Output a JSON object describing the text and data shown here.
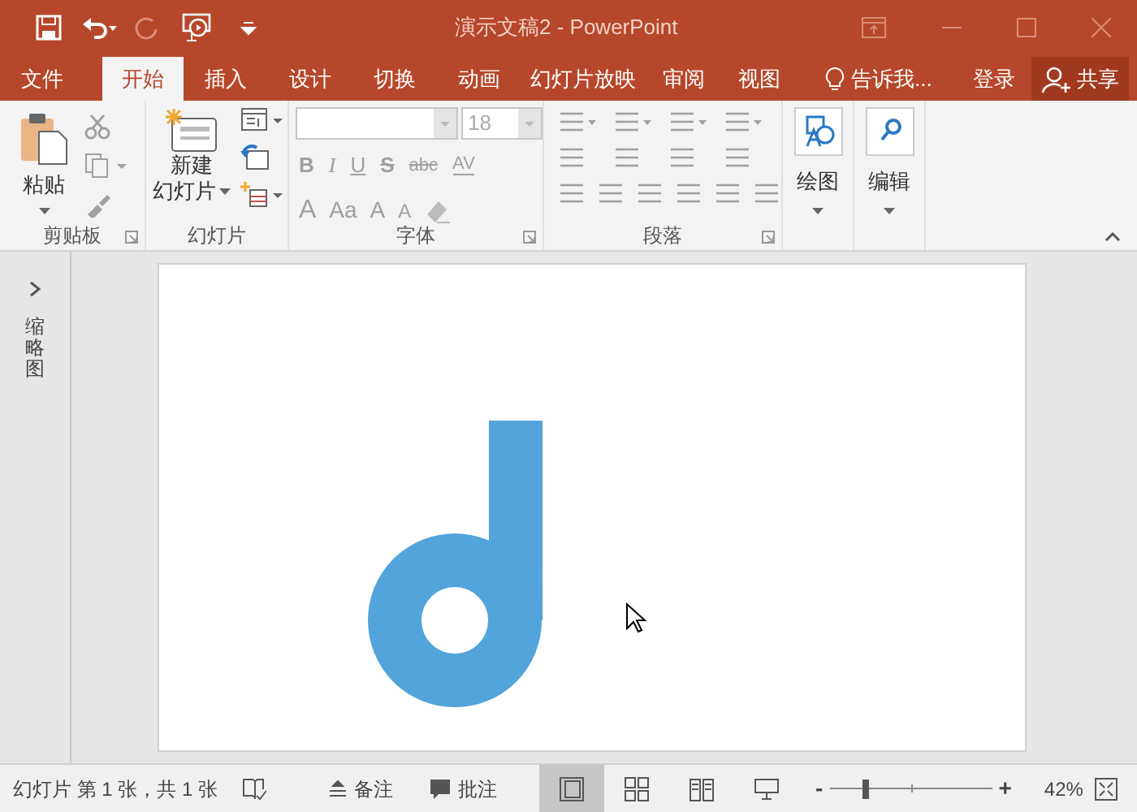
{
  "window": {
    "title": "演示文稿2 - PowerPoint"
  },
  "tabs": [
    {
      "label": "文件",
      "selected": false
    },
    {
      "label": "开始",
      "selected": true
    },
    {
      "label": "插入",
      "selected": false
    },
    {
      "label": "设计",
      "selected": false
    },
    {
      "label": "切换",
      "selected": false
    },
    {
      "label": "动画",
      "selected": false
    },
    {
      "label": "幻灯片放映",
      "selected": false
    },
    {
      "label": "审阅",
      "selected": false
    },
    {
      "label": "视图",
      "selected": false
    }
  ],
  "tell_me": "告诉我...",
  "sign_in": "登录",
  "share": "共享",
  "ribbon": {
    "groups": [
      {
        "label": "剪贴板",
        "launcher": true
      },
      {
        "label": "幻灯片",
        "launcher": false
      },
      {
        "label": "字体",
        "launcher": true
      },
      {
        "label": "段落",
        "launcher": true
      }
    ],
    "paste": "粘贴",
    "new_slide": [
      "新建",
      "幻灯片"
    ],
    "font_size": "18",
    "font_buttons": [
      "B",
      "I",
      "U",
      "S",
      "abc",
      "AV"
    ],
    "font_buttons_2": [
      "A",
      "Aa",
      "A",
      "A"
    ],
    "drawing": "绘图",
    "editing": "编辑"
  },
  "thumbnail_pane": {
    "label": "缩略图"
  },
  "status_bar": {
    "slide_info": "幻灯片 第 1 张，共 1 张",
    "notes": "备注",
    "comments": "批注",
    "views": [
      {
        "selected": true
      },
      {
        "selected": false
      },
      {
        "selected": false
      },
      {
        "selected": false
      }
    ],
    "zoom_out": "-",
    "zoom_in": "+",
    "zoom": {
      "level": 0.21,
      "reading": "42%"
    }
  }
}
